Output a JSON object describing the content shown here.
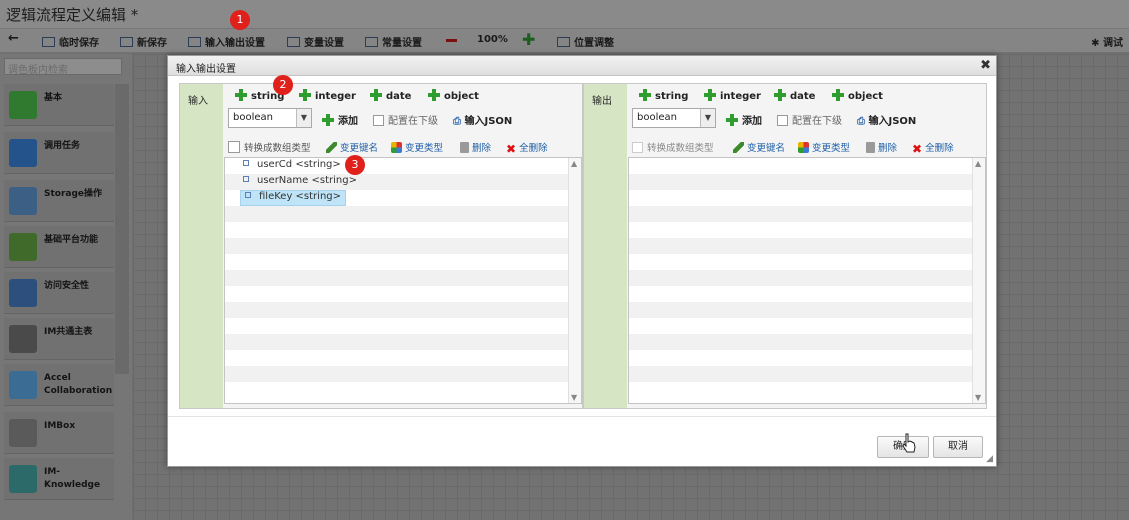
{
  "window": {
    "title": "逻辑流程定义编辑 *"
  },
  "toolbar": {
    "back_icon": "back-arrow-icon",
    "temp_save": "临时保存",
    "new_save": "新保存",
    "io_settings": "输入输出设置",
    "var_settings": "变量设置",
    "const_settings": "常量设置",
    "zoom": "100%",
    "position_adjust": "位置调整",
    "debug": "调试"
  },
  "markers": [
    "1",
    "2",
    "3"
  ],
  "palette": {
    "search_placeholder": "调色板内检索",
    "items": [
      "基本",
      "调用任务",
      "Storage操作",
      "基础平台功能",
      "访问安全性",
      "IM共通主表",
      "Accel Collaboration",
      "IMBox",
      "IM-Knowledge"
    ]
  },
  "dialog": {
    "title": "输入输出设置",
    "close_icon": "close-icon",
    "input": {
      "label": "输入",
      "types": [
        "string",
        "integer",
        "date",
        "object"
      ],
      "select_value": "boolean",
      "add": "添加",
      "place_below": "配置在下级",
      "input_json": "输入JSON",
      "convert_array": "转换成数组类型",
      "rename_key": "变更键名",
      "change_type": "变更类型",
      "delete": "删除",
      "delete_all": "全删除",
      "nodes": [
        "userCd <string>",
        "userName <string>",
        "fileKey <string>"
      ]
    },
    "output": {
      "label": "输出",
      "types": [
        "string",
        "integer",
        "date",
        "object"
      ],
      "select_value": "boolean",
      "add": "添加",
      "place_below": "配置在下级",
      "input_json": "输入JSON",
      "convert_array": "转换成数组类型",
      "rename_key": "变更键名",
      "change_type": "变更类型",
      "delete": "删除",
      "delete_all": "全删除",
      "nodes": []
    },
    "ok": "确定",
    "cancel": "取消"
  },
  "colors": {
    "accent_green": "#2e9c2e",
    "panel_label_bg": "#d6e6c4",
    "link_blue": "#2060a8",
    "marker_red": "#e0201b",
    "selected_row": "#bfe3f7"
  }
}
